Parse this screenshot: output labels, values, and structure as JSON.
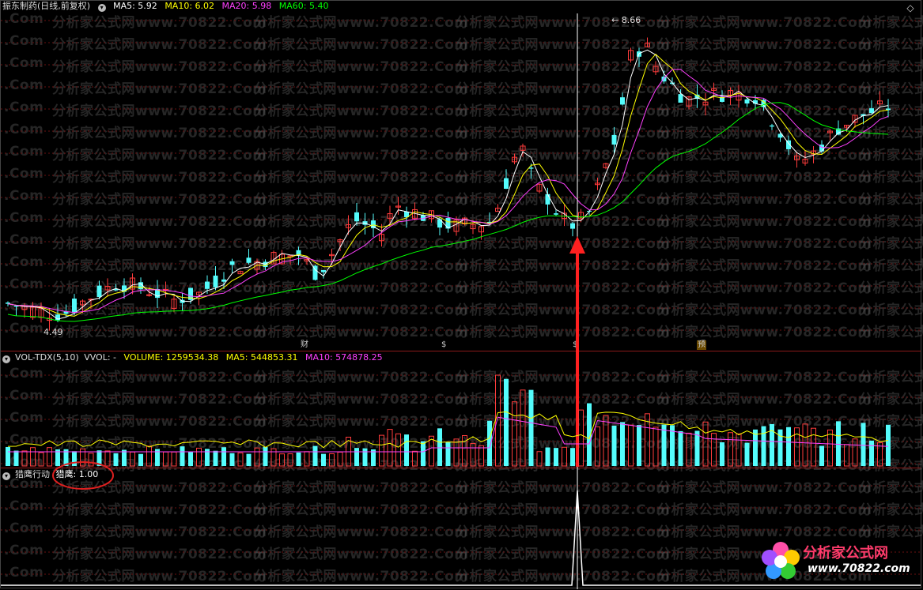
{
  "main_panel": {
    "stock_title": "振东制药(日线,前复权)",
    "indicators": [
      {
        "label": "MA5: 5.92",
        "color": "#ffffff"
      },
      {
        "label": "MA10: 6.02",
        "color": "#ffff00"
      },
      {
        "label": "MA20: 5.98",
        "color": "#ff40ff"
      },
      {
        "label": "MA60: 5.40",
        "color": "#00ff00"
      }
    ],
    "high_label": "8.66",
    "low_label": "4.49",
    "markers": [
      {
        "label": "财",
        "color": "#4a8cff"
      },
      {
        "label": "$",
        "color": "#ff4040"
      },
      {
        "label": "$",
        "color": "#ff4040"
      },
      {
        "label": "预",
        "color": "#d4a100"
      }
    ]
  },
  "vol_panel": {
    "name": "VOL-TDX(5,10)",
    "vvol": "VVOL: -",
    "volume": "VOLUME: 1259534.38",
    "ma5": "MA5: 544853.31",
    "ma10": "MA10: 574878.25"
  },
  "bottom_panel": {
    "name": "猎鹰行动",
    "value_label": "猎鹰: 1.00"
  },
  "watermark": {
    "text": "分析家公式网www.70822.Com",
    "fragment": ".Com"
  },
  "logo": {
    "title": "分析家公式网",
    "url": "www.70822.com"
  },
  "colors": {
    "up": "#ff3c3c",
    "down": "#54fcfc",
    "ma5": "#ffffff",
    "ma10": "#ffff00",
    "ma20": "#ff40ff",
    "ma60": "#00ff00",
    "arrow": "#ff2020",
    "divider": "#8b1a1a"
  }
}
